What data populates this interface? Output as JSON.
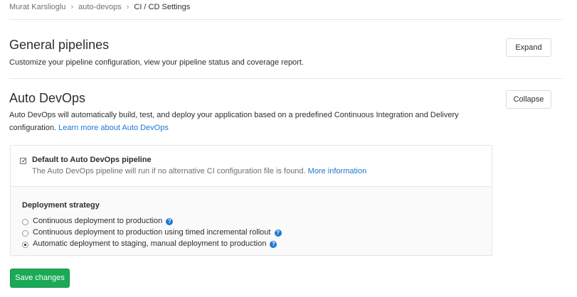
{
  "breadcrumb": {
    "items": [
      "Murat Karslioglu",
      "auto-devops",
      "CI / CD Settings"
    ]
  },
  "general_pipelines": {
    "title": "General pipelines",
    "description": "Customize your pipeline configuration, view your pipeline status and coverage report.",
    "expand_label": "Expand"
  },
  "auto_devops": {
    "title": "Auto DevOps",
    "description": "Auto DevOps will automatically build, test, and deploy your application based on a predefined Continuous Integration and Delivery",
    "description_line2": "configuration.",
    "learn_more": "Learn more about Auto DevOps",
    "collapse_label": "Collapse",
    "default_checkbox": {
      "label": "Default to Auto DevOps pipeline",
      "checked": true,
      "help": "The Auto DevOps pipeline will run if no alternative CI configuration file is found.",
      "help_link": "More information"
    },
    "deployment_strategy": {
      "title": "Deployment strategy",
      "options": [
        {
          "label": "Continuous deployment to production",
          "selected": false
        },
        {
          "label": "Continuous deployment to production using timed incremental rollout",
          "selected": false
        },
        {
          "label": "Automatic deployment to staging, manual deployment to production",
          "selected": true
        }
      ]
    },
    "help_icon": "question-circle-icon"
  },
  "save_button": {
    "label": "Save changes"
  },
  "colors": {
    "link": "#1f78d1",
    "success": "#1aaa55",
    "border": "#e5e5e5",
    "panel_bg": "#fafafa"
  }
}
